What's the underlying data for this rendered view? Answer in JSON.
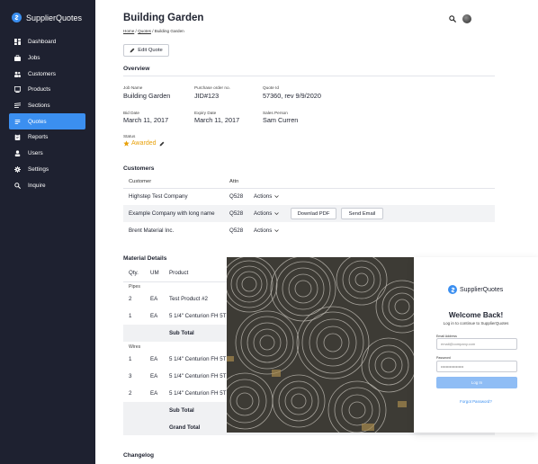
{
  "app": {
    "name": "SupplierQuotes"
  },
  "sidebar": {
    "items": [
      {
        "label": "Dashboard",
        "icon": "dashboard-icon"
      },
      {
        "label": "Jobs",
        "icon": "briefcase-icon"
      },
      {
        "label": "Customers",
        "icon": "people-icon"
      },
      {
        "label": "Products",
        "icon": "monitor-icon"
      },
      {
        "label": "Sections",
        "icon": "sections-icon"
      },
      {
        "label": "Quotes",
        "icon": "list-icon",
        "active": true
      },
      {
        "label": "Reports",
        "icon": "clipboard-icon"
      },
      {
        "label": "Users",
        "icon": "user-icon"
      },
      {
        "label": "Settings",
        "icon": "gear-icon"
      },
      {
        "label": "Inquire",
        "icon": "search-icon"
      }
    ]
  },
  "header": {
    "title": "Building Garden",
    "breadcrumb": {
      "home": "Home",
      "sep1": " / ",
      "quotes": "Quotes",
      "sep2": " / ",
      "current": "Building Garden"
    },
    "edit_label": "Edit Quote"
  },
  "overview": {
    "title": "Overview",
    "job_name_label": "Job Name",
    "job_name": "Building Garden",
    "po_label": "Purchase order no.",
    "po": "JID#123",
    "quote_id_label": "Quote Id",
    "quote_id": "57360, rev 9/9/2020",
    "bid_date_label": "Bid Date",
    "bid_date": "March 11, 2017",
    "expiry_label": "Expiry Date",
    "expiry": "March 11, 2017",
    "sales_label": "Sales Person",
    "sales": "Sam Curren",
    "status_label": "Status",
    "status": "Awarded"
  },
  "customers": {
    "title": "Customers",
    "col_customer": "Customer",
    "col_attn": "Attn",
    "rows": [
      {
        "name": "Highstep Test Company",
        "attn": "Q528",
        "actions": "Actions"
      },
      {
        "name": "Example Company with long name",
        "attn": "Q528",
        "actions": "Actions",
        "pdf": "Downlad PDF",
        "email": "Send Email"
      },
      {
        "name": "Brent Material Inc.",
        "attn": "Q528",
        "actions": "Actions"
      }
    ]
  },
  "materials": {
    "title": "Material Details",
    "col_qty": "Qty.",
    "col_um": "UM",
    "col_product": "Product",
    "group_pipes": "Pipes",
    "group_wires": "Wires",
    "rows_pipes": [
      {
        "qty": "2",
        "um": "EA",
        "product": "Test Product #2"
      },
      {
        "qty": "1",
        "um": "EA",
        "product": "5 1/4\" Centurion FH 5T"
      }
    ],
    "rows_wires": [
      {
        "qty": "1",
        "um": "EA",
        "product": "5 1/4\" Centurion FH 5T"
      },
      {
        "qty": "3",
        "um": "EA",
        "product": "5 1/4\" Centurion FH 5T"
      },
      {
        "qty": "2",
        "um": "EA",
        "product": "5 1/4\" Centurion FH 5T"
      }
    ],
    "sub_total": "Sub Total",
    "grand_total": "Grand Total"
  },
  "changelog": {
    "title": "Changelog"
  },
  "login": {
    "brand": "SupplierQuotes",
    "welcome": "Welcome Back!",
    "subtitle": "Log in to continue to SupplierQuotes",
    "email_label": "Email Address",
    "email_placeholder": "email@company.com",
    "password_label": "Password",
    "password_value": "••••••••••••••••••",
    "login_button": "Log In",
    "forgot": "Forgot Password?"
  },
  "colors": {
    "sidebar": "#1e2130",
    "accent": "#3b8ff0",
    "status": "#e8a10a"
  }
}
